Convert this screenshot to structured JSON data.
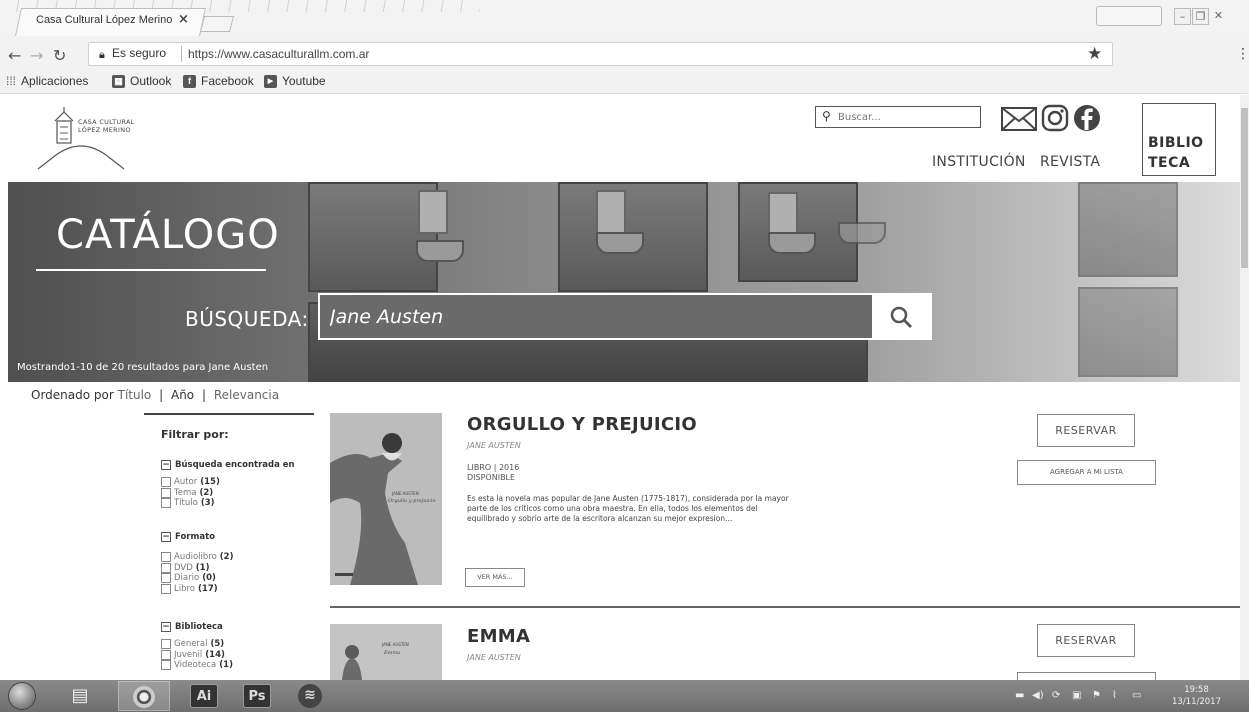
{
  "browser": {
    "tab_title": "Casa Cultural López Merino",
    "tab_close": "×",
    "secure_label": "Es seguro",
    "url": "https://www.casaculturallm.com.ar",
    "bookmarks": [
      {
        "label": "Aplicaciones",
        "icon": "apps-grid-icon"
      },
      {
        "label": "Outlook",
        "icon": "outlook-icon"
      },
      {
        "label": "Facebook",
        "icon": "facebook-icon"
      },
      {
        "label": "Youtube",
        "icon": "youtube-icon"
      }
    ]
  },
  "site": {
    "logo_line1": "CASA CULTURAL",
    "logo_line2": "LÓPEZ MERINO",
    "search_placeholder": "Buscar...",
    "nav": [
      "INSTITUCIÓN",
      "REVISTA"
    ],
    "biblio_line1": "BIBLIO",
    "biblio_line2": "TECA"
  },
  "hero": {
    "title": "CATÁLOGO",
    "search_label": "BÚSQUEDA:",
    "search_value": "Jane Austen",
    "status": "Mostrando1-10 de 20 resultados para Jane Austen"
  },
  "sort": {
    "prefix": "Ordenado por",
    "options": [
      "Título",
      "Año",
      "Relevancia"
    ]
  },
  "filters": {
    "title": "Filtrar por:",
    "sections": [
      {
        "heading": "Búsqueda encontrada en",
        "items": [
          {
            "label": "Autor",
            "count": "(15)"
          },
          {
            "label": "Tema",
            "count": "(2)"
          },
          {
            "label": "Título",
            "count": "(3)"
          }
        ]
      },
      {
        "heading": "Formato",
        "items": [
          {
            "label": "Audiolibro",
            "count": "(2)"
          },
          {
            "label": "DVD",
            "count": "(1)"
          },
          {
            "label": "Diario",
            "count": "(0)"
          },
          {
            "label": "Libro",
            "count": "(17)"
          }
        ]
      },
      {
        "heading": "Biblioteca",
        "items": [
          {
            "label": "General",
            "count": "(5)"
          },
          {
            "label": "Juvenil",
            "count": "(14)"
          },
          {
            "label": "Videoteca",
            "count": "(1)"
          }
        ]
      }
    ]
  },
  "results": [
    {
      "title": "ORGULLO Y PREJUICIO",
      "author": "JANE AUSTEN",
      "meta_line1": "LIBRO | 2016",
      "meta_line2": "DISPONIBLE",
      "description": "Es esta la novela mas popular de Jane Austen (1775-1817), considerada por la mayor parte de los críticos como una obra maestra. En ella, todos los elementos del equilibrado y sobrio arte de la escritora alcanzan su mejor expresion...",
      "cover_author": "JANE AUSTEN",
      "cover_title": "Orgullo y prejuicio",
      "more_label": "VER MÁS...",
      "reserve_label": "RESERVAR",
      "list_label": "AGREGAR A MI LISTA"
    },
    {
      "title": "EMMA",
      "author": "JANE AUSTEN",
      "cover_author": "JANE AUSTEN",
      "cover_title": "Emma",
      "reserve_label": "RESERVAR"
    }
  ],
  "taskbar": {
    "apps": [
      "Ai",
      "Ps"
    ],
    "time": "19:58",
    "date": "13/11/2017"
  }
}
